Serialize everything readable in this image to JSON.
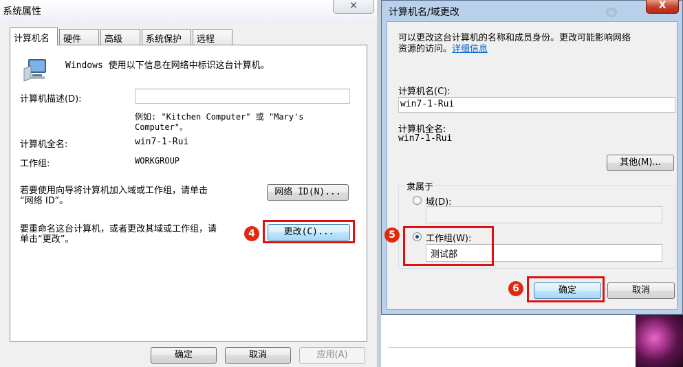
{
  "system_properties": {
    "title": "系统属性",
    "close_glyph": "✕",
    "tabs": [
      {
        "label": "计算机名",
        "active": true
      },
      {
        "label": "硬件"
      },
      {
        "label": "高级"
      },
      {
        "label": "系统保护"
      },
      {
        "label": "远程"
      }
    ],
    "intro_text": "Windows 使用以下信息在网络中标识这台计算机。",
    "description_label": "计算机描述(D):",
    "description_value": "",
    "example_line1": "例如: \"Kitchen Computer\" 或 \"Mary's",
    "example_line2": "Computer\"。",
    "full_name_label": "计算机全名:",
    "full_name_value": "win7-1-Rui",
    "workgroup_label": "工作组:",
    "workgroup_value": "WORKGROUP",
    "wizard_text_line1": "若要使用向导将计算机加入域或工作组，请单击",
    "wizard_text_line2": "“网络 ID”。",
    "network_id_button": "网络 ID(N)...",
    "rename_text_line1": "要重命名这台计算机，或者更改其域或工作组，请",
    "rename_text_line2": "单击“更改”。",
    "change_button": "更改(C)...",
    "ok_button": "确定",
    "cancel_button": "取消",
    "apply_button": "应用(A)"
  },
  "computer_name_dialog": {
    "title": "计算机名/域更改",
    "close_glyph": "X",
    "intro_line1": "可以更改这台计算机的名称和成员身份。更改可能影响网络",
    "intro_line2": "资源的访问。",
    "details_link": "详细信息",
    "computer_name_label": "计算机名(C):",
    "computer_name_value": "win7-1-Rui",
    "full_name_label": "计算机全名:",
    "full_name_value": "win7-1-Rui",
    "more_button": "其他(M)...",
    "member_of_label": "隶属于",
    "domain_radio_label": "域(D):",
    "domain_value": "",
    "workgroup_radio_label": "工作组(W):",
    "workgroup_value": "测试部",
    "selected_membership": "workgroup",
    "ok_button": "确定",
    "cancel_button": "取消"
  },
  "annotations": {
    "step4": "4",
    "step5": "5",
    "step6": "6",
    "highlight_color": "#e01010",
    "marker_color": "#e02a10"
  }
}
